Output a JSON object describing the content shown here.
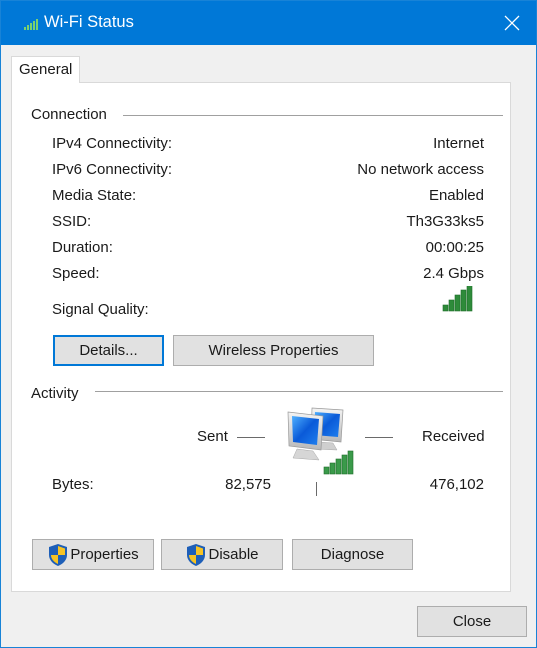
{
  "window": {
    "title": "Wi-Fi Status",
    "title_icon": "wifi-signal-icon",
    "close_icon": "close-icon",
    "accent": "#0078d7"
  },
  "tabs": [
    {
      "label": "General",
      "selected": true
    }
  ],
  "connection": {
    "group_title": "Connection",
    "rows": [
      {
        "label": "IPv4 Connectivity:",
        "value": "Internet"
      },
      {
        "label": "IPv6 Connectivity:",
        "value": "No network access"
      },
      {
        "label": "Media State:",
        "value": "Enabled"
      },
      {
        "label": "SSID:",
        "value": "Th3G33ks5"
      },
      {
        "label": "Duration:",
        "value": "00:00:25"
      },
      {
        "label": "Speed:",
        "value": "2.4 Gbps"
      }
    ],
    "signal_label": "Signal Quality:",
    "signal_bars": 5,
    "signal_bars_max": 5,
    "signal_color": "#2e8b3a",
    "details_button": "Details...",
    "wireless_properties_button": "Wireless Properties"
  },
  "activity": {
    "group_title": "Activity",
    "sent_label": "Sent",
    "received_label": "Received",
    "bytes_label": "Bytes:",
    "bytes_sent": "82,575",
    "bytes_received": "476,102",
    "network_icon": "network-computers-icon"
  },
  "actions": {
    "properties_button": "Properties",
    "disable_button": "Disable",
    "diagnose_button": "Diagnose",
    "shield_icon": "uac-shield-icon"
  },
  "footer": {
    "close_button": "Close"
  }
}
